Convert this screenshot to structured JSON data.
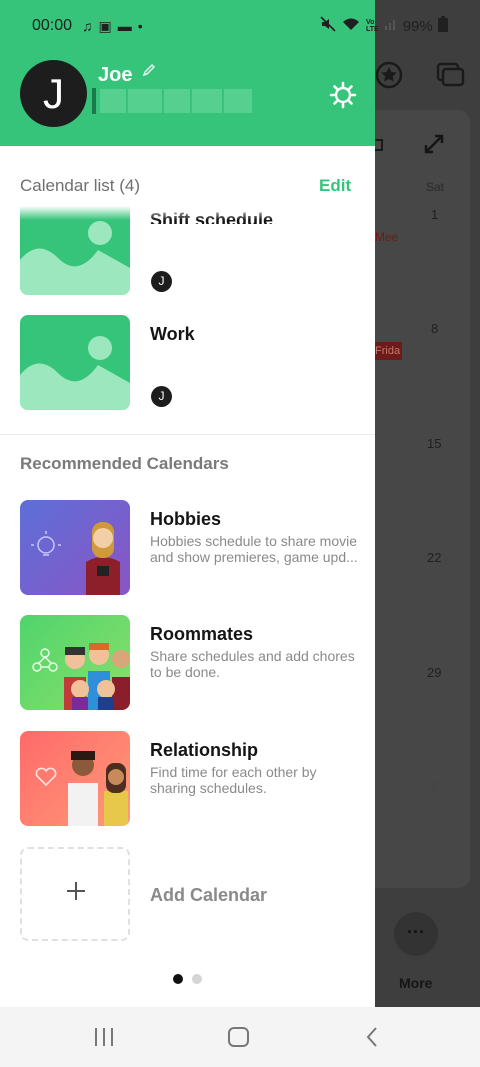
{
  "status_bar": {
    "time": "00:00",
    "battery": "99%"
  },
  "background": {
    "weekday_sat": "Sat",
    "dates": [
      "1",
      "8",
      "15",
      "22",
      "29",
      "6"
    ],
    "event_1": "Mee",
    "event_2": "Frida",
    "more_label": "More"
  },
  "drawer": {
    "user": {
      "avatar_initial": "J",
      "name": "Joe"
    },
    "calendar_list": {
      "heading": "Calendar list (4)",
      "edit_label": "Edit",
      "items": [
        {
          "title": "Shift schedule",
          "member_initial": "J"
        },
        {
          "title": "Work",
          "member_initial": "J"
        }
      ]
    },
    "recommended": {
      "heading": "Recommended Calendars",
      "items": [
        {
          "title": "Hobbies",
          "description": "Hobbies schedule to share movie and show premieres, game upd..."
        },
        {
          "title": "Roommates",
          "description": "Share schedules and add chores to be done."
        },
        {
          "title": "Relationship",
          "description": "Find time for each other by sharing schedules."
        }
      ],
      "add_label": "Add Calendar"
    },
    "pager": {
      "current": 1,
      "total": 2
    }
  },
  "colors": {
    "accent_green": "#36c47b",
    "hobbies_bg": "#6a66d4",
    "roommates_bg": "#5fd86b",
    "relationship_bg": "#ff7a6a"
  },
  "icons": {
    "gear": "gear-icon",
    "pencil": "pencil-icon",
    "plus": "plus-icon"
  }
}
